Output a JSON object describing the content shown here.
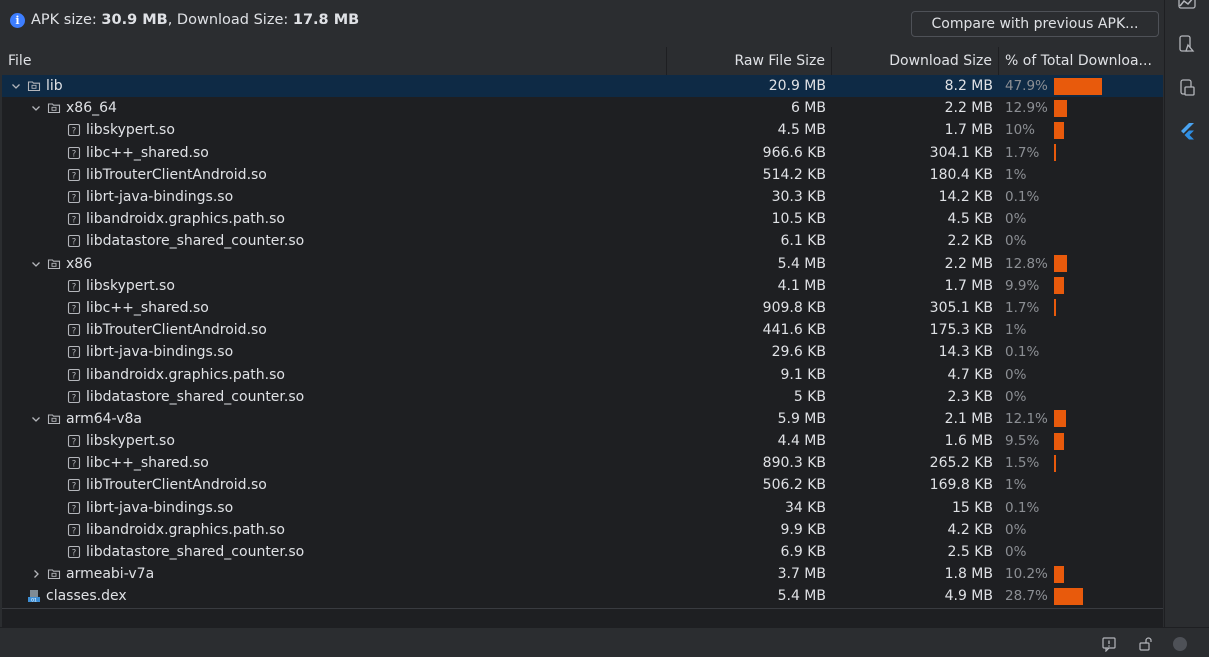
{
  "summary": {
    "apk_label": "APK size: ",
    "apk_value": "30.9 MB",
    "sep": ", Download Size: ",
    "dl_value": "17.8 MB",
    "compare_button": "Compare with previous APK..."
  },
  "columns": {
    "file": "File",
    "raw": "Raw File Size",
    "download": "Download Size",
    "percent": "% of Total Downloa..."
  },
  "colors": {
    "bar": "#e85a0c",
    "selected": "#0e2a45"
  },
  "rows": [
    {
      "name": "lib",
      "depth": 0,
      "kind": "folder",
      "expanded": true,
      "raw": "20.9 MB",
      "dl": "8.2 MB",
      "pct": "47.9%",
      "fraction": 0.479,
      "selected": true
    },
    {
      "name": "x86_64",
      "depth": 1,
      "kind": "folder",
      "expanded": true,
      "raw": "6 MB",
      "dl": "2.2 MB",
      "pct": "12.9%",
      "fraction": 0.129
    },
    {
      "name": "libskypert.so",
      "depth": 2,
      "kind": "file",
      "raw": "4.5 MB",
      "dl": "1.7 MB",
      "pct": "10%",
      "fraction": 0.1
    },
    {
      "name": "libc++_shared.so",
      "depth": 2,
      "kind": "file",
      "raw": "966.6 KB",
      "dl": "304.1 KB",
      "pct": "1.7%",
      "fraction": 0.017
    },
    {
      "name": "libTrouterClientAndroid.so",
      "depth": 2,
      "kind": "file",
      "raw": "514.2 KB",
      "dl": "180.4 KB",
      "pct": "1%",
      "fraction": 0.0
    },
    {
      "name": "librt-java-bindings.so",
      "depth": 2,
      "kind": "file",
      "raw": "30.3 KB",
      "dl": "14.2 KB",
      "pct": "0.1%",
      "fraction": 0.0
    },
    {
      "name": "libandroidx.graphics.path.so",
      "depth": 2,
      "kind": "file",
      "raw": "10.5 KB",
      "dl": "4.5 KB",
      "pct": "0%",
      "fraction": 0.0
    },
    {
      "name": "libdatastore_shared_counter.so",
      "depth": 2,
      "kind": "file",
      "raw": "6.1 KB",
      "dl": "2.2 KB",
      "pct": "0%",
      "fraction": 0.0
    },
    {
      "name": "x86",
      "depth": 1,
      "kind": "folder",
      "expanded": true,
      "raw": "5.4 MB",
      "dl": "2.2 MB",
      "pct": "12.8%",
      "fraction": 0.128
    },
    {
      "name": "libskypert.so",
      "depth": 2,
      "kind": "file",
      "raw": "4.1 MB",
      "dl": "1.7 MB",
      "pct": "9.9%",
      "fraction": 0.099
    },
    {
      "name": "libc++_shared.so",
      "depth": 2,
      "kind": "file",
      "raw": "909.8 KB",
      "dl": "305.1 KB",
      "pct": "1.7%",
      "fraction": 0.017
    },
    {
      "name": "libTrouterClientAndroid.so",
      "depth": 2,
      "kind": "file",
      "raw": "441.6 KB",
      "dl": "175.3 KB",
      "pct": "1%",
      "fraction": 0.0
    },
    {
      "name": "librt-java-bindings.so",
      "depth": 2,
      "kind": "file",
      "raw": "29.6 KB",
      "dl": "14.3 KB",
      "pct": "0.1%",
      "fraction": 0.0
    },
    {
      "name": "libandroidx.graphics.path.so",
      "depth": 2,
      "kind": "file",
      "raw": "9.1 KB",
      "dl": "4.7 KB",
      "pct": "0%",
      "fraction": 0.0
    },
    {
      "name": "libdatastore_shared_counter.so",
      "depth": 2,
      "kind": "file",
      "raw": "5 KB",
      "dl": "2.3 KB",
      "pct": "0%",
      "fraction": 0.0
    },
    {
      "name": "arm64-v8a",
      "depth": 1,
      "kind": "folder",
      "expanded": true,
      "raw": "5.9 MB",
      "dl": "2.1 MB",
      "pct": "12.1%",
      "fraction": 0.121
    },
    {
      "name": "libskypert.so",
      "depth": 2,
      "kind": "file",
      "raw": "4.4 MB",
      "dl": "1.6 MB",
      "pct": "9.5%",
      "fraction": 0.095
    },
    {
      "name": "libc++_shared.so",
      "depth": 2,
      "kind": "file",
      "raw": "890.3 KB",
      "dl": "265.2 KB",
      "pct": "1.5%",
      "fraction": 0.015
    },
    {
      "name": "libTrouterClientAndroid.so",
      "depth": 2,
      "kind": "file",
      "raw": "506.2 KB",
      "dl": "169.8 KB",
      "pct": "1%",
      "fraction": 0.0
    },
    {
      "name": "librt-java-bindings.so",
      "depth": 2,
      "kind": "file",
      "raw": "34 KB",
      "dl": "15 KB",
      "pct": "0.1%",
      "fraction": 0.0
    },
    {
      "name": "libandroidx.graphics.path.so",
      "depth": 2,
      "kind": "file",
      "raw": "9.9 KB",
      "dl": "4.2 KB",
      "pct": "0%",
      "fraction": 0.0
    },
    {
      "name": "libdatastore_shared_counter.so",
      "depth": 2,
      "kind": "file",
      "raw": "6.9 KB",
      "dl": "2.5 KB",
      "pct": "0%",
      "fraction": 0.0
    },
    {
      "name": "armeabi-v7a",
      "depth": 1,
      "kind": "folder",
      "expanded": false,
      "raw": "3.7 MB",
      "dl": "1.8 MB",
      "pct": "10.2%",
      "fraction": 0.102
    },
    {
      "name": "classes.dex",
      "depth": 0,
      "kind": "dex",
      "raw": "5.4 MB",
      "dl": "4.9 MB",
      "pct": "28.7%",
      "fraction": 0.287
    }
  ],
  "toolbar_icons": [
    "chart-icon",
    "device-test-icon",
    "device-manager-icon",
    "flutter-icon"
  ],
  "status_icons": [
    "notification-icon",
    "lock-icon",
    "status-dot-icon"
  ]
}
